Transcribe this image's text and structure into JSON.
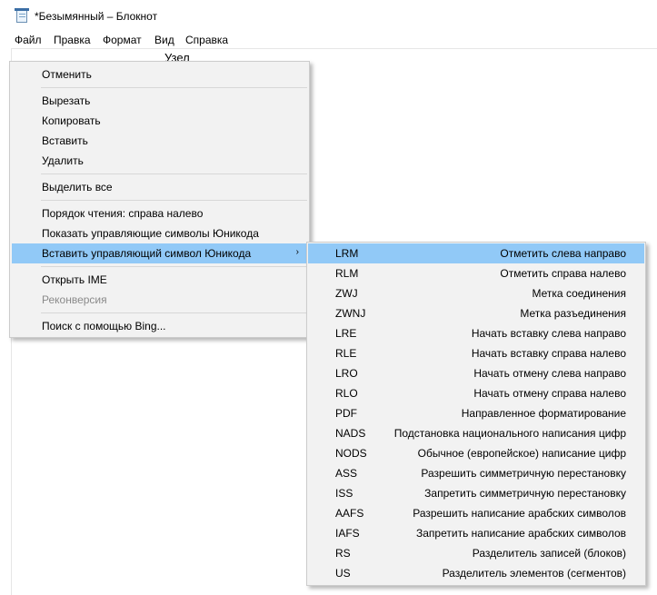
{
  "window": {
    "title": "*Безымянный – Блокнот",
    "icon": "notepad-icon"
  },
  "menubar": {
    "items": [
      "Файл",
      "Правка",
      "Формат",
      "Вид",
      "Справка"
    ]
  },
  "editor": {
    "text": "Узел"
  },
  "context_menu": {
    "items": [
      {
        "label": "Отменить"
      },
      {
        "label": "Вырезать"
      },
      {
        "label": "Копировать"
      },
      {
        "label": "Вставить"
      },
      {
        "label": "Удалить"
      },
      {
        "label": "Выделить все"
      },
      {
        "label": "Порядок чтения: справа налево"
      },
      {
        "label": "Показать управляющие символы Юникода"
      },
      {
        "label": "Вставить управляющий символ Юникода",
        "submenu_arrow": "›",
        "highlighted": true
      },
      {
        "label": "Открыть IME"
      },
      {
        "label": "Реконверсия",
        "disabled": true
      },
      {
        "label": "Поиск с помощью Bing..."
      }
    ]
  },
  "submenu": {
    "items": [
      {
        "code": "LRM",
        "desc": "Отметить слева направо",
        "highlighted": true
      },
      {
        "code": "RLM",
        "desc": "Отметить справа налево"
      },
      {
        "code": "ZWJ",
        "desc": "Метка соединения"
      },
      {
        "code": "ZWNJ",
        "desc": "Метка разъединения"
      },
      {
        "code": "LRE",
        "desc": "Начать вставку слева направо"
      },
      {
        "code": "RLE",
        "desc": "Начать вставку справа налево"
      },
      {
        "code": "LRO",
        "desc": "Начать отмену слева направо"
      },
      {
        "code": "RLO",
        "desc": "Начать отмену справа налево"
      },
      {
        "code": "PDF",
        "desc": "Направленное форматирование"
      },
      {
        "code": "NADS",
        "desc": "Подстановка национального написания цифр"
      },
      {
        "code": "NODS",
        "desc": "Обычное (европейское) написание цифр"
      },
      {
        "code": "ASS",
        "desc": "Разрешить симметричную перестановку"
      },
      {
        "code": "ISS",
        "desc": "Запретить симметричную перестановку"
      },
      {
        "code": "AAFS",
        "desc": "Разрешить написание арабских символов"
      },
      {
        "code": "IAFS",
        "desc": "Запретить написание арабских символов"
      },
      {
        "code": "RS",
        "desc": "Разделитель записей (блоков)"
      },
      {
        "code": "US",
        "desc": "Разделитель элементов (сегментов)"
      }
    ]
  },
  "colors": {
    "highlight": "#91c9f7",
    "menu_bg": "#f2f2f2",
    "disabled_text": "#8a8a8a"
  }
}
